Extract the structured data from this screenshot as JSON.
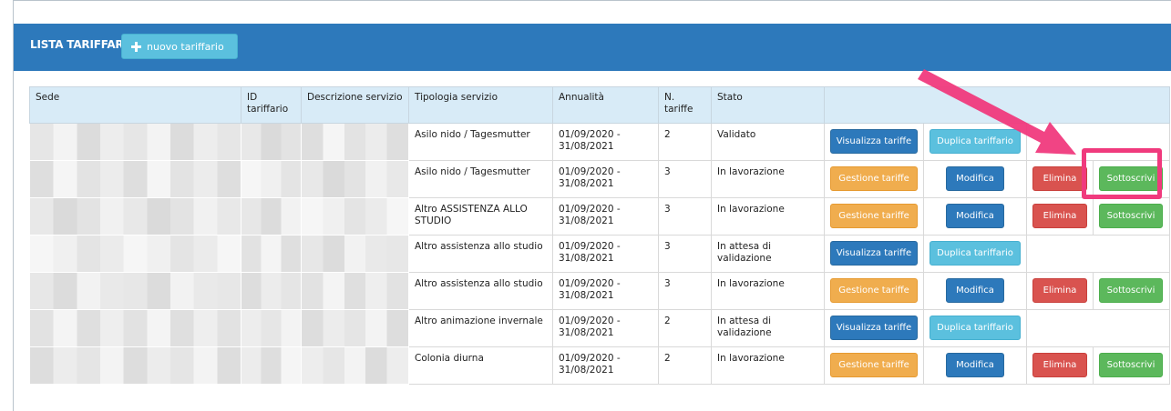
{
  "panel": {
    "title": "LISTA TARIFFARI",
    "new_button_label": "nuovo tariffario"
  },
  "table": {
    "headers": [
      "Sede",
      "ID tariffario",
      "Descrizione servizio",
      "Tipologia servizio",
      "Annualità",
      "N. tariffe",
      "Stato",
      ""
    ],
    "rows": [
      {
        "tipologia": "Asilo nido / Tagesmutter",
        "annualita": "01/09/2020 - 31/08/2021",
        "n_tariffe": "2",
        "stato": "Validato",
        "actions": [
          "Visualizza tariffe",
          "Duplica tariffario"
        ]
      },
      {
        "tipologia": "Asilo nido / Tagesmutter",
        "annualita": "01/09/2020 - 31/08/2021",
        "n_tariffe": "3",
        "stato": "In lavorazione",
        "actions": [
          "Gestione tariffe",
          "Modifica",
          "Elimina",
          "Sottoscrivi"
        ]
      },
      {
        "tipologia": "Altro ASSISTENZA ALLO STUDIO",
        "annualita": "01/09/2020 - 31/08/2021",
        "n_tariffe": "3",
        "stato": "In lavorazione",
        "actions": [
          "Gestione tariffe",
          "Modifica",
          "Elimina",
          "Sottoscrivi"
        ]
      },
      {
        "tipologia": "Altro assistenza allo studio",
        "annualita": "01/09/2020 - 31/08/2021",
        "n_tariffe": "3",
        "stato": "In attesa di validazione",
        "actions": [
          "Visualizza tariffe",
          "Duplica tariffario"
        ]
      },
      {
        "tipologia": "Altro assistenza allo studio",
        "annualita": "01/09/2020 - 31/08/2021",
        "n_tariffe": "3",
        "stato": "In lavorazione",
        "actions": [
          "Gestione tariffe",
          "Modifica",
          "Elimina",
          "Sottoscrivi"
        ]
      },
      {
        "tipologia": "Altro animazione invernale",
        "annualita": "01/09/2020 - 31/08/2021",
        "n_tariffe": "2",
        "stato": "In attesa di validazione",
        "actions": [
          "Visualizza tariffe",
          "Duplica tariffario"
        ]
      },
      {
        "tipologia": "Colonia diurna",
        "annualita": "01/09/2020 - 31/08/2021",
        "n_tariffe": "2",
        "stato": "In lavorazione",
        "actions": [
          "Gestione tariffe",
          "Modifica",
          "Elimina",
          "Sottoscrivi"
        ]
      }
    ]
  },
  "colors": {
    "header_blue": "#2d79bb",
    "cyan": "#5bc0de",
    "orange": "#f0ad4e",
    "red": "#d9534f",
    "green": "#5cb85c",
    "annotation_pink": "#f03a7d"
  },
  "annotation": {
    "icon": "arrow-icon",
    "highlight": "highlight-box"
  }
}
